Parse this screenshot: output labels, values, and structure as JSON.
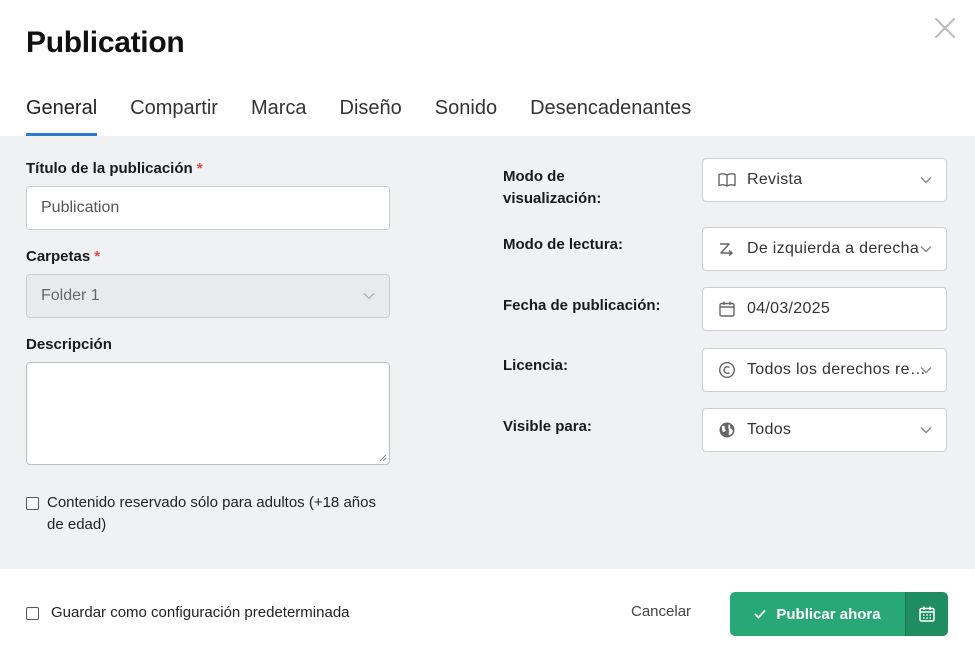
{
  "dialog": {
    "title": "Publication",
    "close_icon": "close-icon"
  },
  "tabs": [
    {
      "label": "General",
      "active": true
    },
    {
      "label": "Compartir"
    },
    {
      "label": "Marca"
    },
    {
      "label": "Diseño"
    },
    {
      "label": "Sonido"
    },
    {
      "label": "Desencadenantes"
    }
  ],
  "form": {
    "title_label": "Título de la publicación",
    "title_value": "Publication",
    "required_mark": "*",
    "folders_label": "Carpetas",
    "folders_value": "Folder 1",
    "description_label": "Descripción",
    "description_value": "",
    "adult_label": "Contenido reservado sólo para adultos (+18 años de edad)",
    "adult_checked": false
  },
  "settings": {
    "view_mode_label": "Modo de visualización:",
    "view_mode_value": "Revista",
    "reading_mode_label": "Modo de lectura:",
    "reading_mode_value": "De izquierda a derecha",
    "publish_date_label": "Fecha de publicación:",
    "publish_date_value": "04/03/2025",
    "license_label": "Licencia:",
    "license_value": "Todos los derechos reservados",
    "visible_label": "Visible para:",
    "visible_value": "Todos"
  },
  "footer": {
    "default_label": "Guardar como configuración predeterminada",
    "default_checked": false,
    "cancel_label": "Cancelar",
    "publish_label": "Publicar ahora"
  },
  "colors": {
    "accent_tab": "#2d7bd1",
    "publish_green": "#28a877",
    "publish_green_dark": "#1f8c62",
    "required_red": "#e04848",
    "panel_bg": "#f0f1f3"
  }
}
